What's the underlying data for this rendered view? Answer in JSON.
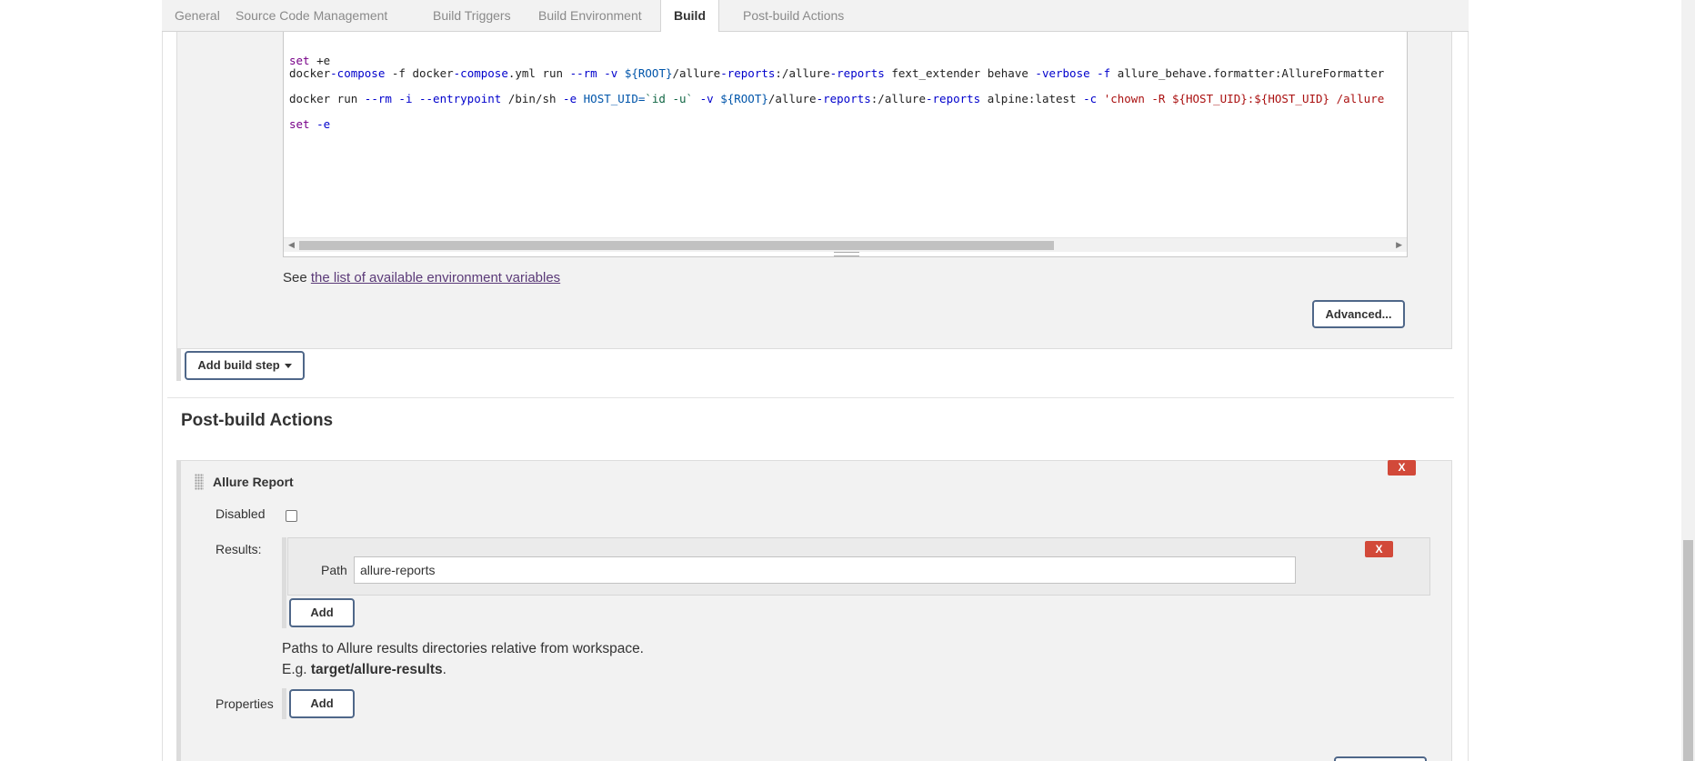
{
  "tabs": [
    {
      "label": "General",
      "active": false
    },
    {
      "label": "Source Code Management",
      "active": false
    },
    {
      "label": "Build Triggers",
      "active": false
    },
    {
      "label": "Build Environment",
      "active": false
    },
    {
      "label": "Build",
      "active": true
    },
    {
      "label": "Post-build Actions",
      "active": false
    }
  ],
  "build_step": {
    "code": {
      "line1": {
        "kw": "set",
        "rest": " +e"
      },
      "line2": {
        "cmd": "docker",
        "op1": "-compose",
        "t1": " -f docker",
        "op2": "-compose",
        "t2": ".yml run ",
        "op3": "--rm -v",
        "sp1": " ",
        "var1": "${ROOT}",
        "t3": "/allure",
        "op4": "-reports",
        "t4": ":/allure",
        "op5": "-reports",
        "t5": " fext_extender behave ",
        "op6": "-verbose -f",
        "t6": " allure_behave.formatter:AllureFormatter"
      },
      "line3": {
        "t1": "docker run ",
        "op1": "--rm -i --entrypoint",
        "t2": " /bin/sh ",
        "op2": "-e",
        "sp1": " ",
        "var1": "HOST_UID=",
        "str1": "`id -u`",
        "sp2": " ",
        "op3": "-v",
        "sp3": " ",
        "var2": "${ROOT}",
        "t3": "/allure",
        "op4": "-reports",
        "t4": ":/allure",
        "op5": "-reports",
        "t5": " alpine:latest ",
        "op6": "-c",
        "sp4": " ",
        "str2": "'chown -R ${HOST_UID}:${HOST_UID} /allure"
      },
      "line4": {
        "kw": "set",
        "op": " -e"
      }
    },
    "env_prefix": "See ",
    "env_link": "the list of available environment variables",
    "advanced_button": "Advanced...",
    "add_build_step_button": "Add build step"
  },
  "post_build": {
    "title": "Post-build Actions",
    "allure": {
      "title": "Allure Report",
      "remove_label": "X",
      "disabled_label": "Disabled",
      "disabled_checked": false,
      "results_label": "Results:",
      "path_label": "Path",
      "path_value": "allure-reports",
      "path_remove_label": "X",
      "add_result_button": "Add",
      "help_line1": "Paths to Allure results directories relative from workspace.",
      "help_line2_prefix": "E.g. ",
      "help_line2_bold": "target/allure-results",
      "help_line2_suffix": ".",
      "properties_label": "Properties",
      "add_property_button": "Add"
    }
  },
  "icons": [
    "drag-handle-icon",
    "caret-down-icon",
    "scroll-left-arrow-icon",
    "scroll-right-arrow-icon"
  ]
}
